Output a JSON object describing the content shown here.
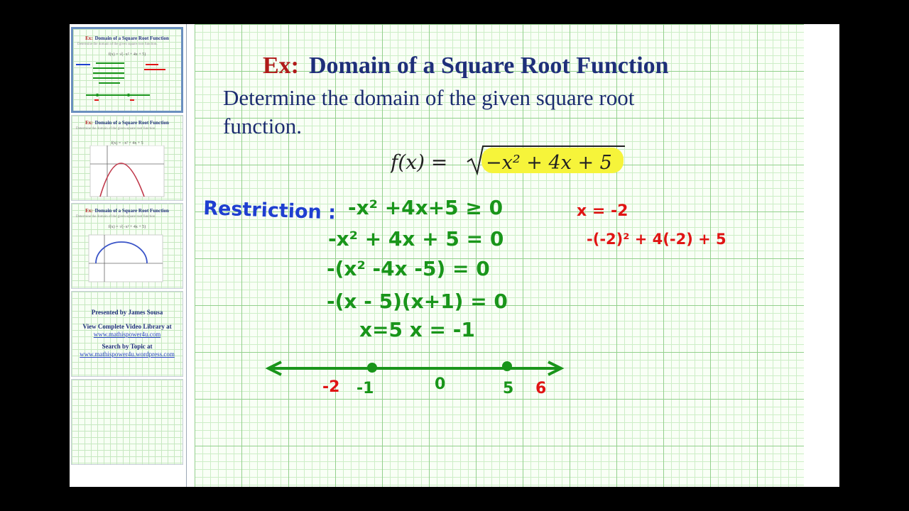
{
  "slides": [
    {
      "ex": "Ex:",
      "title": "Domain of a Square Root Function",
      "subtitle": "Determine the domain of the given square root function.",
      "formula": "f(x) = √(−x² + 4x + 5)",
      "selected": true
    },
    {
      "ex": "Ex:",
      "title": "Domain of a Square Root Function",
      "subtitle": "Determine the domain of the given square root function.",
      "formula": "f(x) = −x² + 4x + 5"
    },
    {
      "ex": "Ex:",
      "title": "Domain of a Square Root Function",
      "subtitle": "Determine the domain of the given square root function.",
      "formula": "f(x) = √(−x² + 4x + 5)"
    }
  ],
  "credits": {
    "presented_by": "Presented by James Sousa",
    "view_library": "View Complete Video Library at",
    "library_url": "www.mathispower4u.com",
    "search_by": "Search by Topic at",
    "search_url": "www.mathispower4u.wordpress.com"
  },
  "slide": {
    "ex": "Ex:",
    "title": "Domain of a Square Root Function",
    "prompt_line1": "Determine the domain of the given square root",
    "prompt_line2": "function.",
    "formula": {
      "lhs": "f(x) =",
      "radicand": "−x² + 4x + 5"
    }
  },
  "handwriting": {
    "restriction_label": "Restriction :",
    "lines": [
      "-x² +4x+5 ≥ 0",
      "-x² + 4x + 5 = 0",
      "-(x² -4x -5) = 0",
      "-(x - 5)(x+1) = 0",
      "x=5   x = -1"
    ],
    "number_line_labels": [
      "-2",
      "-1",
      "0",
      "5",
      "6"
    ],
    "test_value": "x = -2",
    "test_expression": "-(-2)² + 4(-2) + 5"
  },
  "colors": {
    "title_blue": "#1f2f7a",
    "ex_red": "#b01a1a",
    "ink_green": "#19951a",
    "ink_blue": "#1f3fd0",
    "ink_red": "#e01414",
    "highlight": "#f6f43a"
  }
}
